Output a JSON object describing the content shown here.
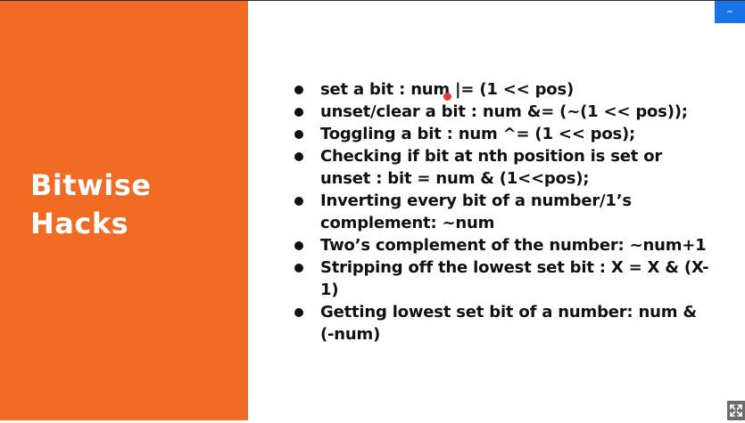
{
  "slide": {
    "title_line1": "Bitwise",
    "title_line2": "Hacks",
    "bullets": [
      "set a bit : num |= (1 << pos)",
      "unset/clear a bit : num &= (~(1 << pos));",
      "Toggling a bit : num ^= (1 << pos);",
      "Checking if bit at nth position is set or unset : bit = num & (1<<pos);",
      "Inverting every bit of a number/1’s complement: ~num",
      "Two’s complement of the number: ~num+1",
      "Stripping off the lowest set bit : X = X & (X-1)",
      "Getting lowest set bit of a number: num & (-num)"
    ]
  },
  "controls": {
    "minimize_label": "–",
    "minimize_icon": "minimize-icon",
    "fullscreen_icon": "expand-icon"
  },
  "colors": {
    "accent_orange": "#f26b25",
    "button_blue": "#1a73e8",
    "pointer_red": "#e53935"
  }
}
